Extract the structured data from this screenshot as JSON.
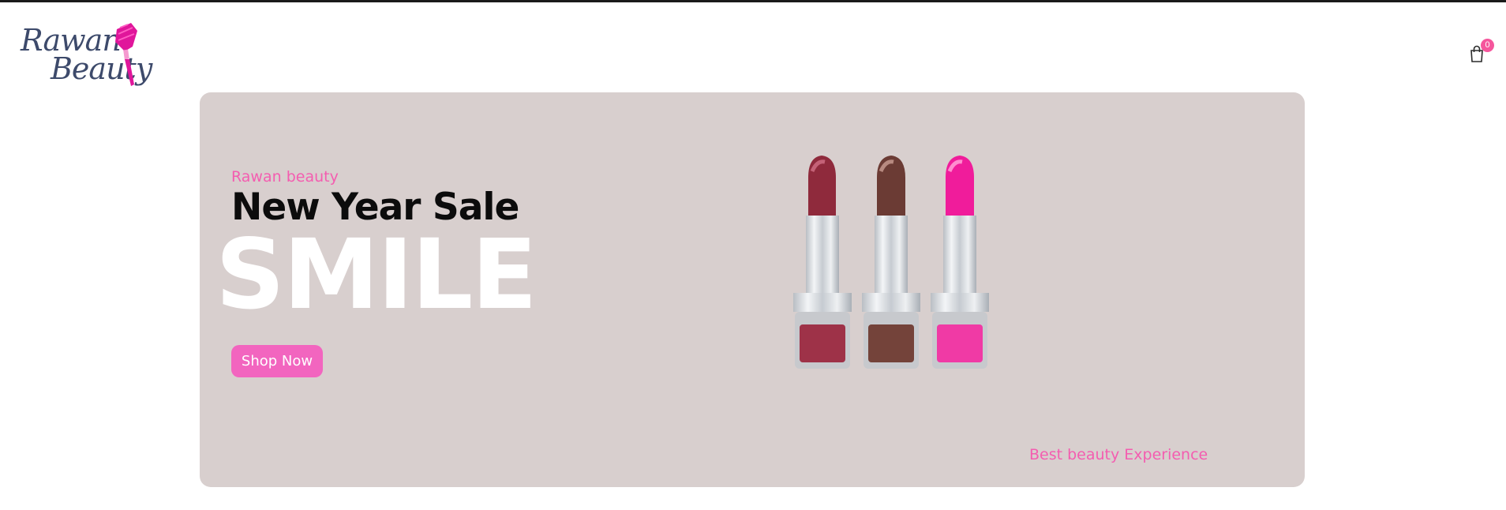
{
  "header": {
    "logo": {
      "line1": "Rawan",
      "line2": "Beauty",
      "brush_color": "#e0169b"
    },
    "cart": {
      "icon": "shopping-bag-icon",
      "count": "0",
      "badge_color": "#f5569c"
    }
  },
  "hero": {
    "background": "#d8cfce",
    "kicker": "Rawan beauty",
    "headline": "New Year Sale",
    "big_word": "SMILE",
    "cta_label": "Shop Now",
    "tagline": "Best beauty Experience",
    "product_image": "three-lipsticks-image",
    "lipstick_colors": [
      "#8f2a3c",
      "#6b3b34",
      "#f01c9b"
    ],
    "accent_color": "#f265bf"
  }
}
